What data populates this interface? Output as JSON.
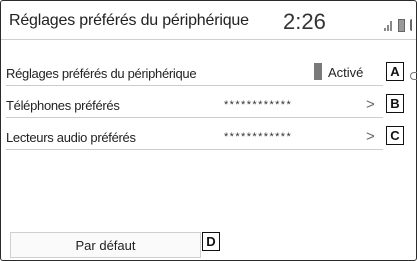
{
  "header": {
    "title": "Réglages préférés du périphérique",
    "clock": "2:26"
  },
  "settings": {
    "device_preference": {
      "label": "Réglages préférés du périphérique",
      "status": "Activé",
      "callout": "A"
    },
    "preferred_phones": {
      "label": "Téléphones préférés",
      "value": "************",
      "chevron": ">",
      "callout": "B"
    },
    "preferred_audio": {
      "label": "Lecteurs audio préférés",
      "value": "************",
      "chevron": ">",
      "callout": "C"
    }
  },
  "footer": {
    "default_label": "Par défaut",
    "callout": "D"
  },
  "icons": [
    "signal-icon",
    "battery-icon",
    "chevron-right-icon"
  ]
}
